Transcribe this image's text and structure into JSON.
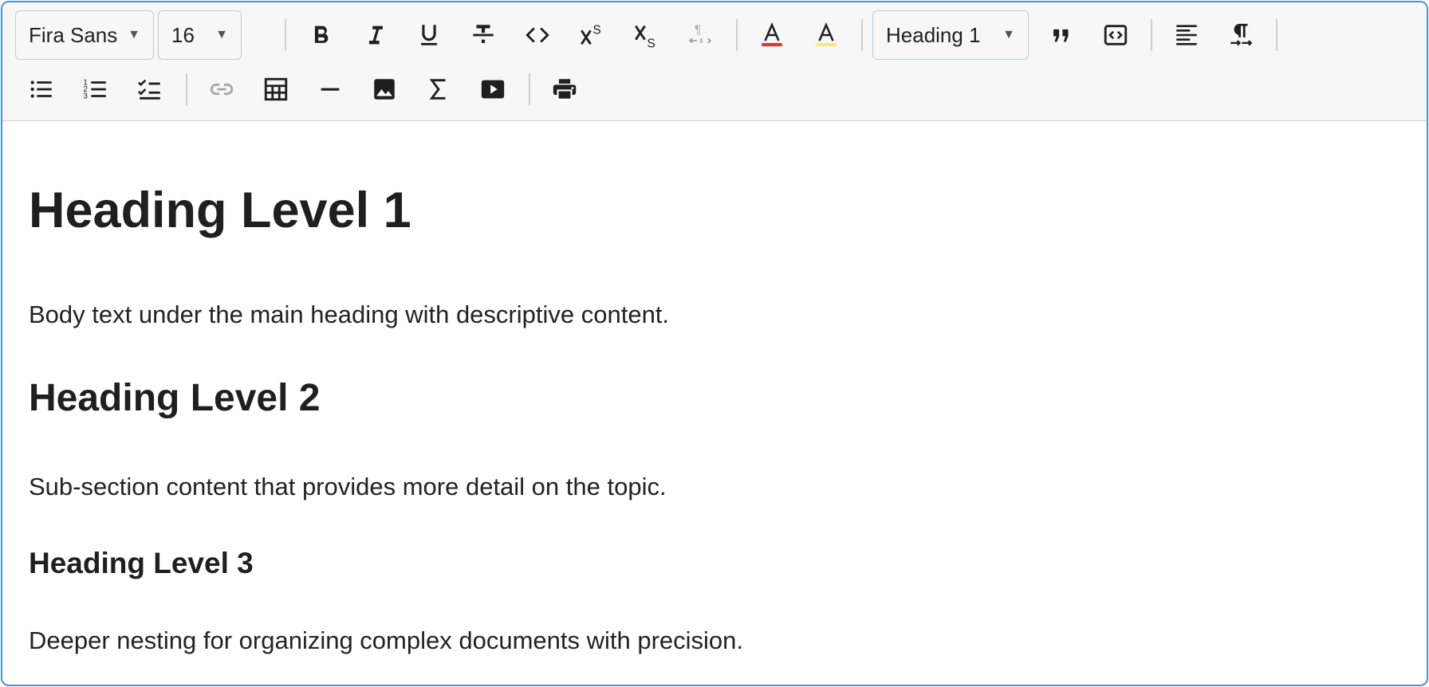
{
  "toolbar": {
    "font_family": "Fira Sans",
    "font_size": "16",
    "block_format": "Heading 1",
    "colors": {
      "text_color_underline": "#d63a3a",
      "highlight_underline": "#f7e87a",
      "disabled_icon": "#a8a8a8",
      "focus_border": "#4a90d9"
    }
  },
  "document": {
    "h1": "Heading Level 1",
    "p1": "Body text under the main heading with descriptive content.",
    "h2": "Heading Level 2",
    "p2": "Sub-section content that provides more detail on the topic.",
    "h3": "Heading Level 3",
    "p3": "Deeper nesting for organizing complex documents with precision."
  }
}
